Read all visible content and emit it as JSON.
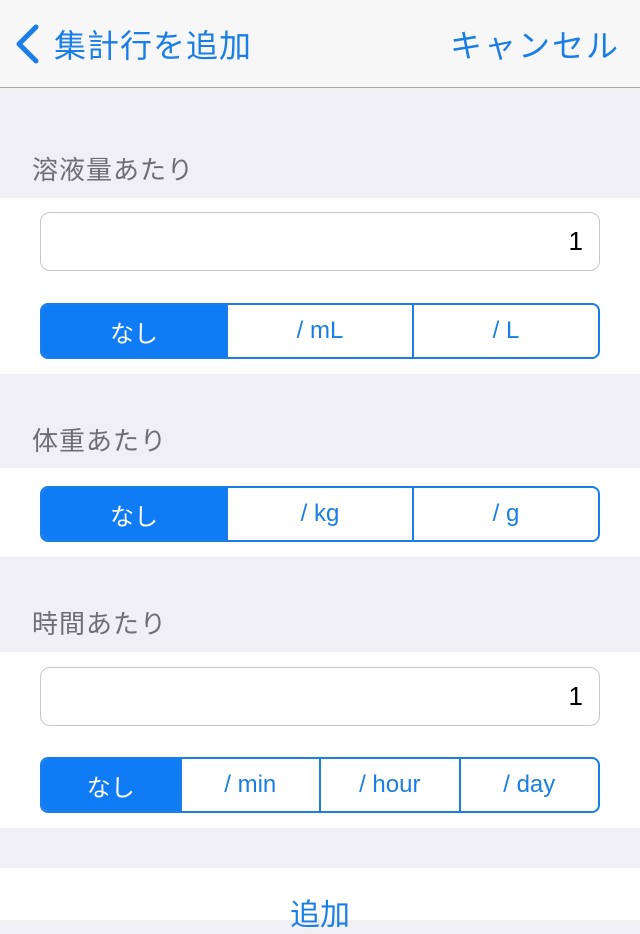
{
  "nav": {
    "back_label": "集計行を追加",
    "cancel_label": "キャンセル",
    "accent_color": "#1a7ee6"
  },
  "sections": [
    {
      "header": "溶液量あたり",
      "input_value": "1",
      "segments": [
        "なし",
        "/ mL",
        "/ L"
      ],
      "selected": "なし"
    },
    {
      "header": "体重あたり",
      "segments": [
        "なし",
        "/ kg",
        "/ g"
      ],
      "selected": "なし"
    },
    {
      "header": "時間あたり",
      "input_value": "1",
      "segments": [
        "なし",
        "/ min",
        "/ hour",
        "/ day"
      ],
      "selected": "なし"
    }
  ],
  "add_button_label": "追加"
}
